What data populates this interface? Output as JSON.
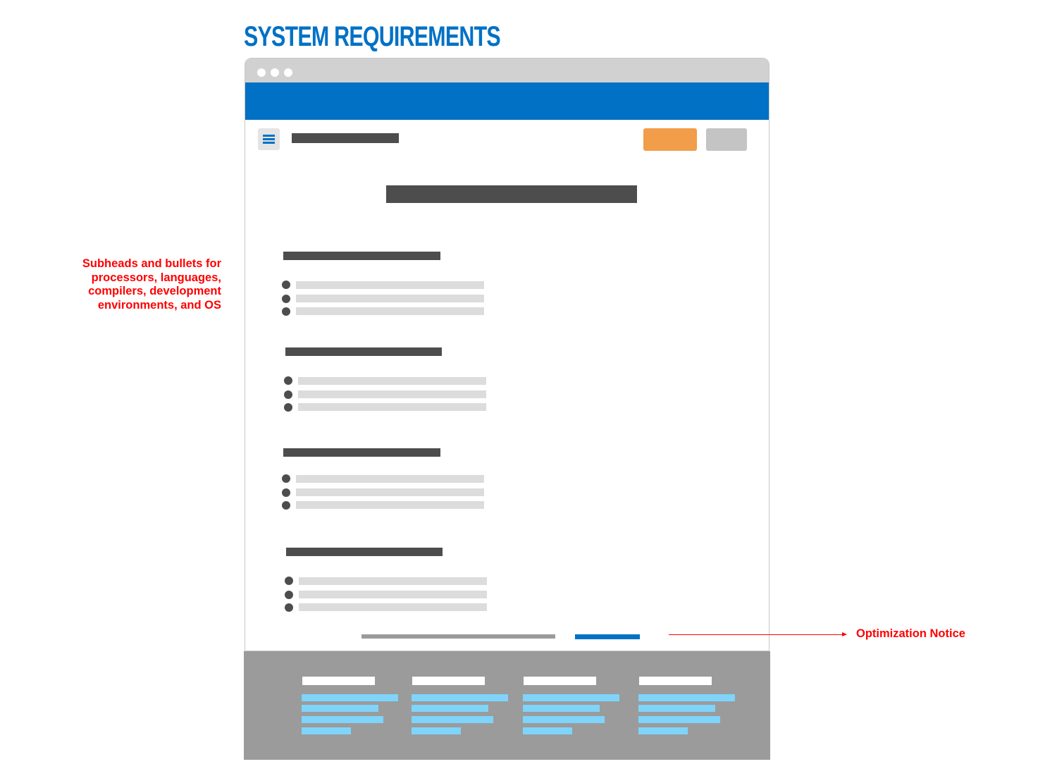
{
  "title": "SYSTEM REQUIREMENTS",
  "annotations": {
    "left": "Subheads and bullets for processors, languages, compilers, development environments, and OS",
    "right": "Optimization Notice"
  },
  "colors": {
    "brand_blue": "#0071c5",
    "cta_orange": "#f29d49",
    "cta_gray": "#c4c4c4",
    "placeholder_dark": "#4d4d4d",
    "placeholder_light": "#dcdcdc",
    "footer_bg": "#9b9b9b",
    "footer_link": "#7ed4fa",
    "annotation_red": "#ff0000"
  },
  "icons": {
    "menu": "hamburger-menu-icon"
  },
  "mockup": {
    "sections": 4,
    "bullets_per_section": 3,
    "footer_columns": 4,
    "links_per_footer_column": 4
  }
}
